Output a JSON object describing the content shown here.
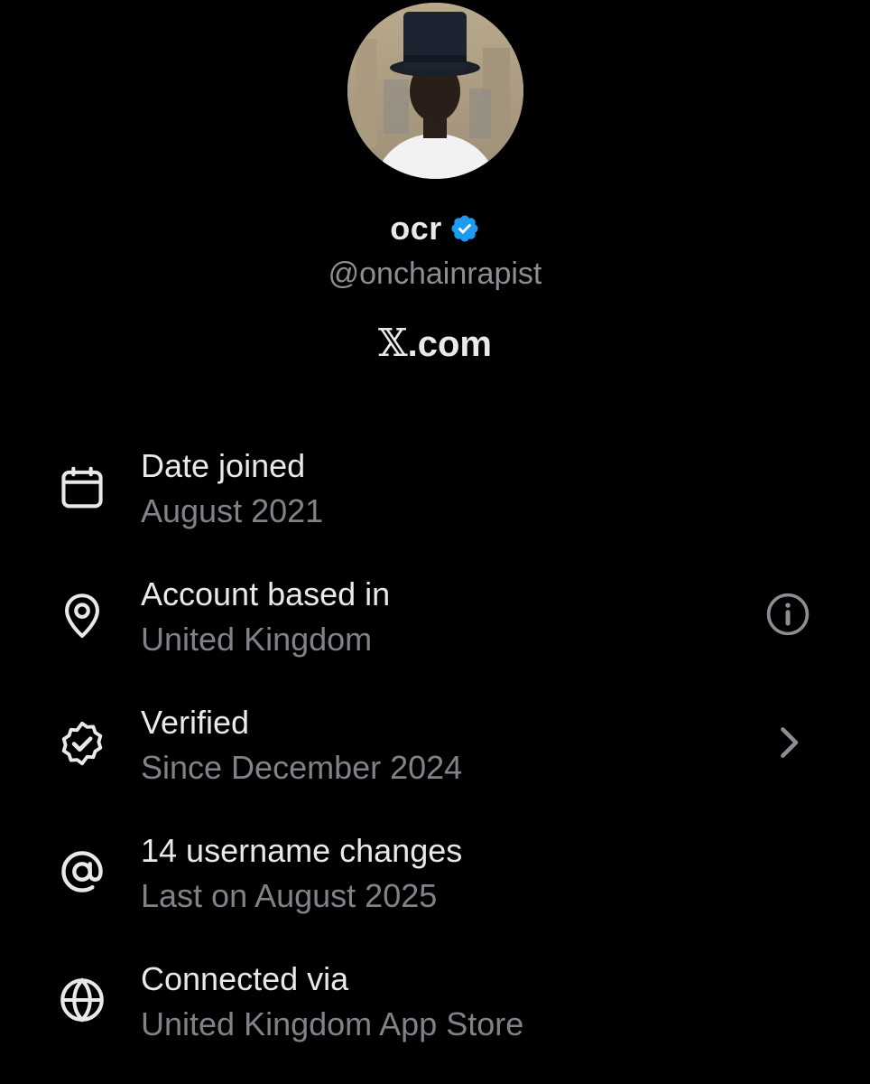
{
  "profile": {
    "display_name": "ocr",
    "handle": "@onchainrapist",
    "platform": "X.com",
    "platform_glyph": "𝕏",
    "platform_suffix": ".com",
    "verified_color": "#1d9bf0"
  },
  "info_rows": [
    {
      "icon": "calendar-icon",
      "title": "Date joined",
      "subtitle": "August 2021",
      "action": null
    },
    {
      "icon": "location-pin-icon",
      "title": "Account based in",
      "subtitle": "United Kingdom",
      "action": "info-icon"
    },
    {
      "icon": "verified-badge-icon",
      "title": "Verified",
      "subtitle": "Since December 2024",
      "action": "chevron-right-icon"
    },
    {
      "icon": "at-sign-icon",
      "title": "14 username changes",
      "subtitle": "Last on August 2025",
      "action": null
    },
    {
      "icon": "globe-icon",
      "title": "Connected via",
      "subtitle": "United Kingdom App Store",
      "action": null
    }
  ],
  "colors": {
    "background": "#000000",
    "primary_text": "#e7e9ea",
    "secondary_text": "#7f8388",
    "icon_muted": "#8b8f94"
  }
}
